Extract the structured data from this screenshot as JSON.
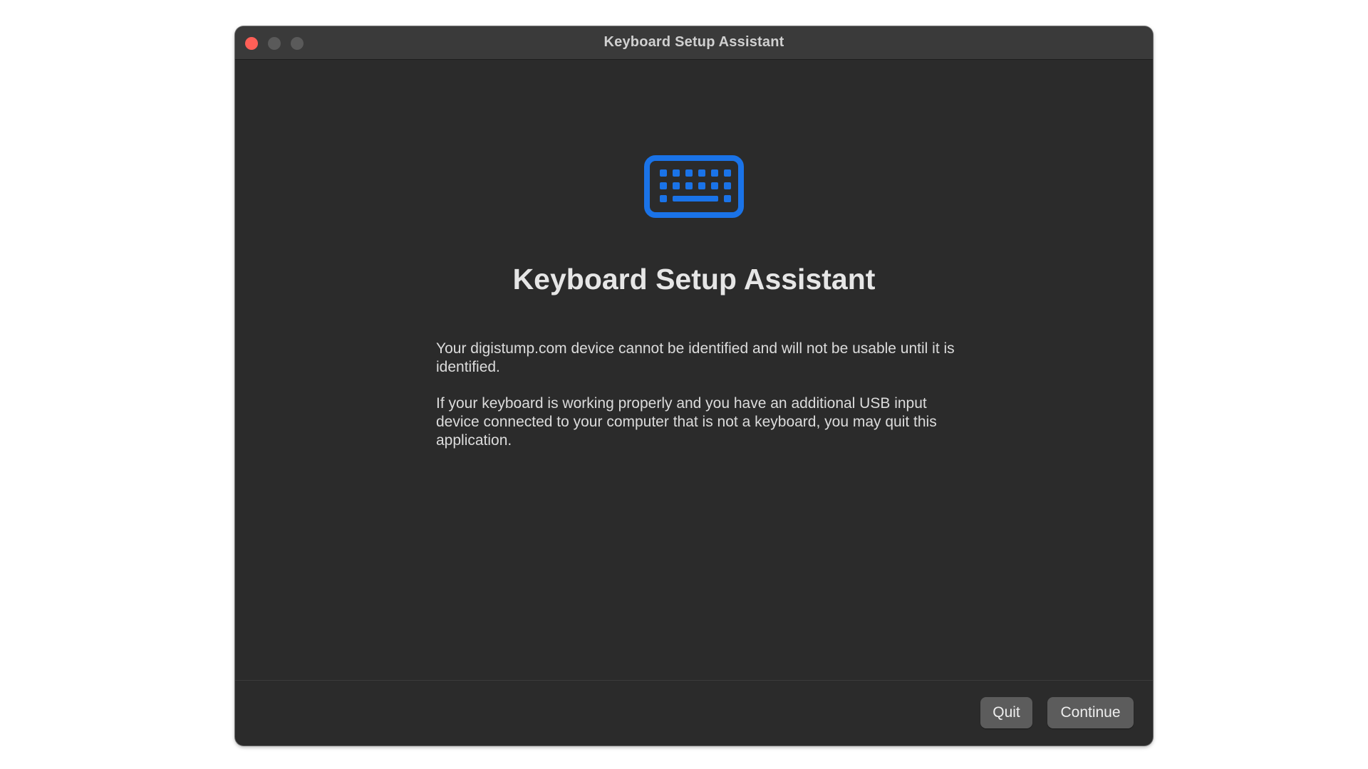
{
  "window": {
    "title": "Keyboard Setup Assistant"
  },
  "icons": {
    "hero": "keyboard-icon",
    "accent_color": "#1a73e8"
  },
  "main": {
    "heading": "Keyboard Setup Assistant",
    "paragraph_1": "Your digistump.com device cannot be identified and will not be usable until it is identified.",
    "paragraph_2": "If your keyboard is working properly and you have an additional USB input device connected to your computer that is not a keyboard, you may quit this application."
  },
  "footer": {
    "quit_label": "Quit",
    "continue_label": "Continue"
  },
  "colors": {
    "window_bg": "#2b2b2b",
    "titlebar_bg": "#3a3a3a",
    "close_button": "#ff5f57",
    "button_bg": "#5c5c5c"
  }
}
